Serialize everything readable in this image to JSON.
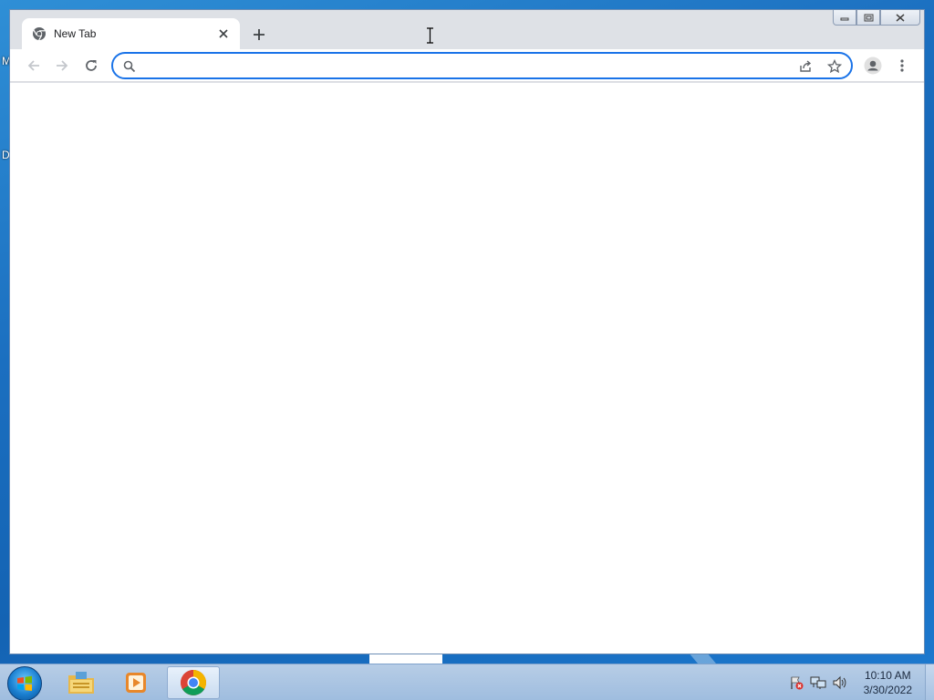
{
  "desktop": {
    "letters": [
      "M",
      "D"
    ]
  },
  "browser": {
    "tab": {
      "title": "New Tab",
      "favicon": "chrome-icon",
      "close_icon": "close-icon"
    },
    "new_tab_icon": "plus-icon",
    "window_controls": {
      "minimize_icon": "minimize-icon",
      "maximize_icon": "restore-icon",
      "close_icon": "close-icon"
    },
    "toolbar": {
      "back_icon": "arrow-left-icon",
      "forward_icon": "arrow-right-icon",
      "reload_icon": "reload-icon",
      "omnibox": {
        "value": "",
        "placeholder": "",
        "search_icon": "search-icon",
        "share_icon": "share-icon",
        "bookmark_icon": "star-icon"
      },
      "profile_icon": "profile-icon",
      "menu_icon": "kebab-menu-icon"
    },
    "accent_color": "#1a73e8"
  },
  "taskbar": {
    "start_icon": "windows-start-icon",
    "apps": [
      {
        "name": "file-explorer-icon",
        "active": false
      },
      {
        "name": "media-player-icon",
        "active": false
      },
      {
        "name": "chrome-icon",
        "active": true
      }
    ],
    "tray": {
      "icons": [
        "action-center-flag-icon",
        "network-icon",
        "volume-icon"
      ],
      "time": "10:10 AM",
      "date": "3/30/2022"
    }
  }
}
